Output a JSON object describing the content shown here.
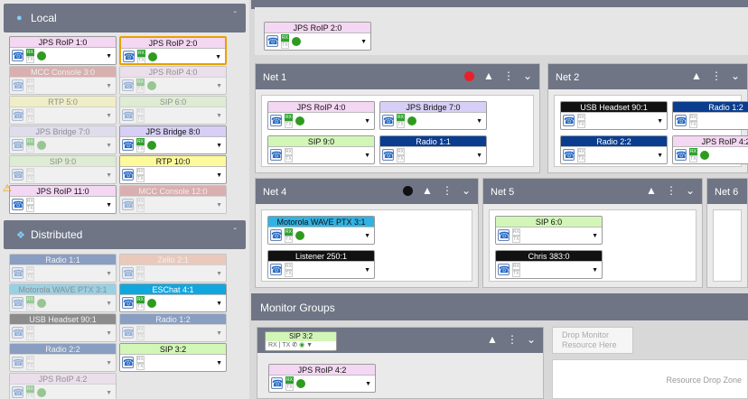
{
  "sidebar": {
    "local": {
      "title": "Local",
      "icon": "location-pin-icon",
      "chevron": "ˇ",
      "cards": [
        {
          "label": "JPS RoIP 1:0",
          "color": "pink",
          "dot": true,
          "ghost": false
        },
        {
          "label": "JPS RoIP 2:0",
          "color": "pink",
          "dot": true,
          "ghost": false,
          "selected": true
        },
        {
          "label": "MCC Console 3:0",
          "color": "red",
          "ghost": true
        },
        {
          "label": "JPS RoIP 4:0",
          "color": "pink",
          "ghost": true,
          "dot": true
        },
        {
          "label": "RTP 5:0",
          "color": "yellow",
          "ghost": true
        },
        {
          "label": "SIP 6:0",
          "color": "lgreen",
          "ghost": true
        },
        {
          "label": "JPS Bridge 7:0",
          "color": "purple",
          "ghost": true,
          "dot": true
        },
        {
          "label": "JPS Bridge 8:0",
          "color": "purple",
          "dot": true,
          "ghost": false
        },
        {
          "label": "SIP 9:0",
          "color": "lgreen",
          "ghost": true
        },
        {
          "label": "RTP 10:0",
          "color": "yellow",
          "ghost": false
        },
        {
          "label": "JPS RoIP 11:0",
          "color": "pink",
          "ghost": false,
          "warning": true
        },
        {
          "label": "MCC Console 12:0",
          "color": "red",
          "ghost": true
        }
      ]
    },
    "distributed": {
      "title": "Distributed",
      "icon": "network-nodes-icon",
      "chevron": "ˇ",
      "cards": [
        {
          "label": "Radio 1:1",
          "color": "blue",
          "ghost": true
        },
        {
          "label": "Zello 2:1",
          "color": "salmon",
          "ghost": true
        },
        {
          "label": "Motorola WAVE PTX 3:1",
          "color": "cyan",
          "ghost": true,
          "dot": true
        },
        {
          "label": "ESChat 4:1",
          "color": "teal",
          "ghost": false,
          "dot": true
        },
        {
          "label": "USB Headset 90:1",
          "color": "black",
          "ghost": true
        },
        {
          "label": "Radio 1:2",
          "color": "blue",
          "ghost": true
        },
        {
          "label": "Radio 2:2",
          "color": "blue",
          "ghost": true
        },
        {
          "label": "SIP 3:2",
          "color": "lgreen",
          "ghost": false
        },
        {
          "label": "JPS RoIP 4:2",
          "color": "pink",
          "ghost": true,
          "dot": true
        }
      ]
    }
  },
  "top_staging": {
    "card": {
      "label": "JPS RoIP 2:0",
      "color": "pink",
      "dot": true
    }
  },
  "nets": [
    {
      "title": "Net 1",
      "record": "#e8202a",
      "cards": [
        {
          "label": "JPS RoIP 4:0",
          "color": "pink",
          "dot": true
        },
        {
          "label": "JPS Bridge 7:0",
          "color": "purple",
          "dot": true
        },
        {
          "label": "SIP 9:0",
          "color": "lgreen"
        },
        {
          "label": "Radio 1:1",
          "color": "blue"
        }
      ]
    },
    {
      "title": "Net 2",
      "cards": [
        {
          "label": "USB Headset 90:1",
          "color": "black"
        },
        {
          "label": "Radio 1:2",
          "color": "blue"
        },
        {
          "label": "Radio 2:2",
          "color": "blue"
        },
        {
          "label": "JPS RoIP 4:2",
          "color": "pink",
          "dot": true
        }
      ]
    },
    {
      "title": "Net 4",
      "record": "#111111",
      "cards": [
        {
          "label": "Motorola WAVE PTX 3:1",
          "color": "cyan",
          "dot": true
        },
        {
          "label": "Listener 250:1",
          "color": "black"
        }
      ]
    },
    {
      "title": "Net 5",
      "cards": [
        {
          "label": "SIP 6:0",
          "color": "lgreen"
        },
        {
          "label": "Chris 383:0",
          "color": "black"
        }
      ]
    },
    {
      "title": "Net 6",
      "cards": []
    }
  ],
  "monitor": {
    "title": "Monitor Groups",
    "group": {
      "label": "SIP 3:2",
      "card": "JPS RoIP 4:2"
    },
    "drop_text": "Drop Monitor Resource Here",
    "zone_text": "Resource Drop Zone"
  },
  "strings": {
    "rx": "RX",
    "tx": "TX"
  }
}
